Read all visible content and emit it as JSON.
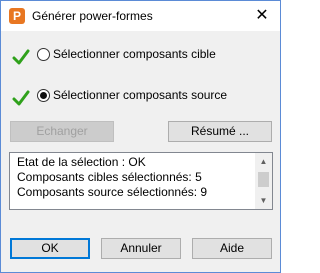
{
  "window": {
    "title": "Générer power-formes",
    "app_icon_letter": "P",
    "close_glyph": "✕"
  },
  "options": [
    {
      "label": "Sélectionner composants cible",
      "selected": false,
      "checked": true
    },
    {
      "label": "Sélectionner composants source",
      "selected": true,
      "checked": true
    }
  ],
  "buttons": {
    "swap": "Echanger",
    "summary": "Résumé ...",
    "ok": "OK",
    "cancel": "Annuler",
    "help": "Aide"
  },
  "status": {
    "lines": [
      "Etat de la sélection : OK",
      "Composants cibles sélectionnés: 5",
      "Composants source sélectionnés: 9"
    ]
  },
  "colors": {
    "check": "#2fa11b",
    "accent": "#0078d7",
    "app_icon": "#e87722"
  }
}
